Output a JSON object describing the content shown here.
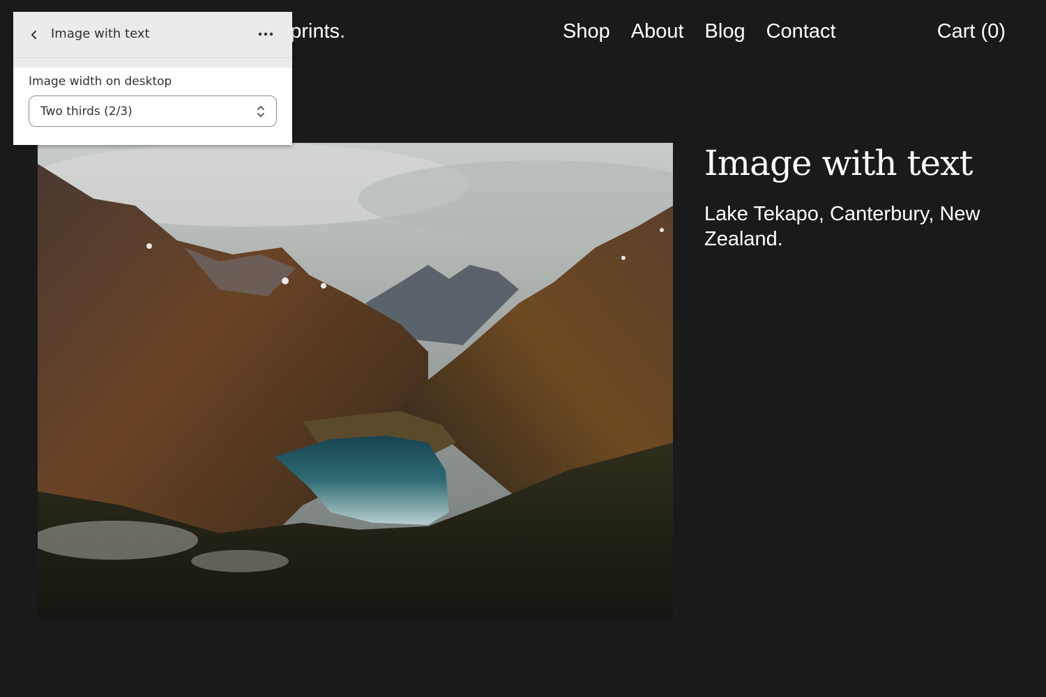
{
  "header": {
    "brand_text": "phy & prints.",
    "nav": [
      "Shop",
      "About",
      "Blog",
      "Contact"
    ],
    "cart_label": "Cart (0)"
  },
  "section": {
    "heading": "Image with text",
    "body": "Lake Tekapo, Canterbury, New Zealand."
  },
  "editor": {
    "back_icon": "chevron-left-icon",
    "title": "Image with text",
    "more_icon": "ellipsis-icon",
    "field_label": "Image width on desktop",
    "select_value": "Two thirds (2/3)",
    "select_icon": "chevron-up-down-icon"
  },
  "colors": {
    "page_background": "#1a1a1a",
    "text": "#ffffff",
    "panel_header": "#ebebeb",
    "panel_text": "#303030"
  }
}
